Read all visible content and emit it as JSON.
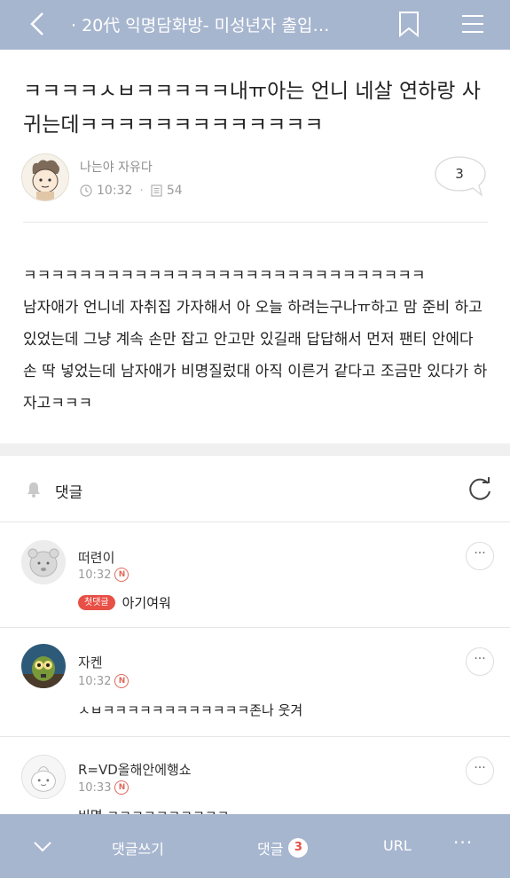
{
  "topbar": {
    "title": "· 20代 익명담화방- 미성년자 출입…",
    "icons": [
      "back-chevron-icon",
      "bookmark-icon",
      "hamburger-menu-icon"
    ]
  },
  "post": {
    "title": "ㅋㅋㅋㅋㅅㅂㅋㅋㅋㅋㅋ내ㅠ아는 언니 네살 연하랑 사귀는데ㅋㅋㅋㅋㅋㅋㅋㅋㅋㅋㅋㅋㅋ",
    "author": "나는야 자유다",
    "time": "10:32",
    "views": "54",
    "comment_count": "3",
    "body_lines": [
      "ㅋㅋㅋㅋㅋㅋㅋㅋㅋㅋㅋㅋㅋㅋㅋㅋㅋㅋㅋㅋㅋㅋㅋㅋㅋㅋㅋㅋㅋ",
      "남자애가 언니네 자취집 가자해서 아 오늘 하려는구나ㅠ하고 맘 준비 하고 있었는데 그냥 계속 손만 잡고 안고만 있길래 답답해서 먼저 팬티 안에다 손 딱 넣었는데 남자애가 비명질렀대 아직 이른거 같다고 조금만 있다가 하자고ㅋㅋㅋ"
    ]
  },
  "comments_section": {
    "label": "댓글",
    "items": [
      {
        "name": "떠련이",
        "time": "10:32",
        "new_badge": "N",
        "first_badge": "첫댓글",
        "text": "아기여워"
      },
      {
        "name": "자켄",
        "time": "10:32",
        "new_badge": "N",
        "text": "ㅅㅂㅋㅋㅋㅋㅋㅋㅋㅋㅋㅋㅋㅋ존나 웃겨"
      },
      {
        "name": "R=VD올해안에행쇼",
        "time": "10:33",
        "new_badge": "N",
        "text": "비명 ㅋㅋㅋㅋㅋㅋㅋㅋㅋㅋ"
      }
    ],
    "more_label": "···"
  },
  "bottombar": {
    "write_label": "댓글쓰기",
    "comments_label": "댓글",
    "comments_count": "3",
    "url_label": "URL",
    "more_label": "···"
  },
  "colors": {
    "bar": "#a7b6cf",
    "badge_red": "#e84f45"
  }
}
